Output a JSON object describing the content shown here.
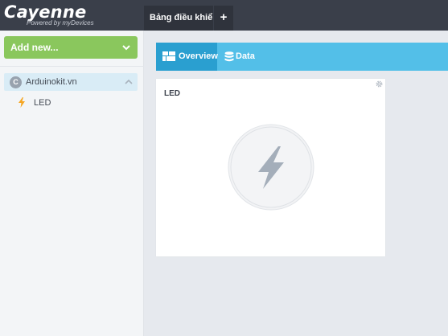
{
  "brand": {
    "name": "Cayenne",
    "tagline": "Powered by myDevices"
  },
  "tabs": {
    "dashboard": "Bảng điều khiển",
    "add": "+"
  },
  "sidebar": {
    "add_new": "Add new...",
    "device": {
      "name": "Arduinokit.vn",
      "icon": "device-icon"
    },
    "widgets": [
      {
        "label": "LED",
        "icon": "lightning-icon"
      }
    ]
  },
  "toolbar": {
    "overview": "Overview",
    "data": "Data"
  },
  "card": {
    "title": "LED",
    "state_icon": "lightning-icon"
  },
  "colors": {
    "topbar": "#3a3f4a",
    "accent_green": "#8ac75d",
    "toolbar_blue": "#53bfe8",
    "toolbar_active": "#2a9fd0",
    "selected_row": "#d9ecf6",
    "bolt_orange": "#f5a623"
  }
}
